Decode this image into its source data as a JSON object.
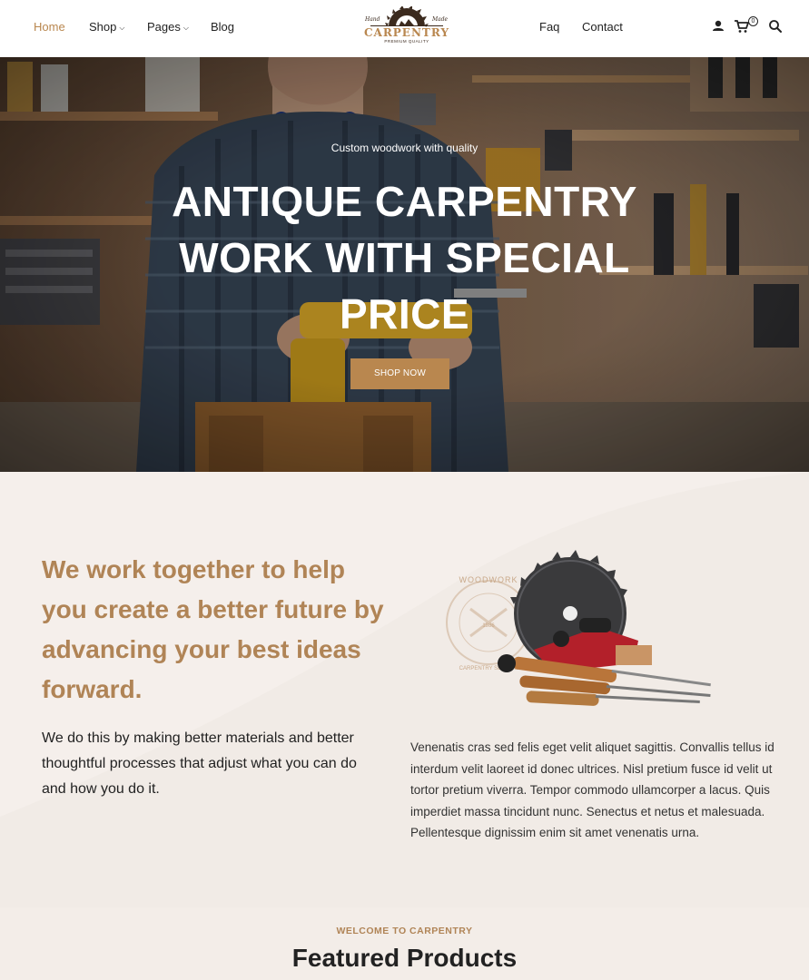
{
  "nav": {
    "left": [
      {
        "label": "Home",
        "active": true
      },
      {
        "label": "Shop",
        "dropdown": true
      },
      {
        "label": "Pages",
        "dropdown": true
      },
      {
        "label": "Blog"
      }
    ],
    "right": [
      {
        "label": "Faq"
      },
      {
        "label": "Contact"
      }
    ],
    "icons": [
      "user-icon",
      "cart-icon",
      "search-icon"
    ],
    "cart_count": "0"
  },
  "logo": {
    "title": "CARPENTRY",
    "tagline": "PREMIUM QUALITY",
    "left_script": "Hand",
    "right_script": "Made"
  },
  "hero": {
    "eyebrow": "Custom woodwork with quality",
    "title_line1": "ANTIQUE CARPENTRY",
    "title_line2": "WORK WITH SPECIAL",
    "title_line3": "PRICE",
    "button": "SHOP NOW"
  },
  "about": {
    "heading": "We work together to help you create a better future by advancing your best ideas forward.",
    "subtext": "We do this by making better materials and better thoughtful processes that adjust what you can do and how you do it.",
    "paragraph": "Venenatis cras sed felis eget velit aliquet sagittis. Convallis tellus id interdum velit laoreet id donec ultrices. Nisl pretium fusce id velit ut tortor pretium viverra. Tempor commodo ullamcorper a lacus. Quis imperdiet massa tincidunt nunc. Senectus et netus et malesuada. Pellentesque dignissim enim sit amet venenatis urna.",
    "stamp_text": "WOODWORK",
    "stamp_sub": "CARPENTRY SERVICE",
    "stamp_year": "1986"
  },
  "featured": {
    "eyebrow": "WELCOME TO CARPENTRY",
    "title": "Featured Products"
  },
  "colors": {
    "accent": "#b9874f",
    "heading_gold": "#b08456",
    "section_bg": "#f5efeb"
  }
}
